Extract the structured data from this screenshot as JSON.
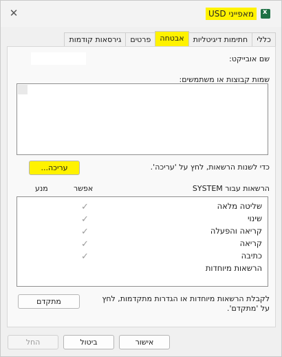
{
  "window": {
    "title": "מאפייני USD",
    "close_glyph": "✕",
    "app_icon": "excel-icon"
  },
  "tabs": [
    {
      "label": "כללי",
      "active": false
    },
    {
      "label": "חתימות דיגיטליות",
      "active": false
    },
    {
      "label": "אבטחה",
      "active": true
    },
    {
      "label": "פרטים",
      "active": false
    },
    {
      "label": "גירסאות קודמות",
      "active": false
    }
  ],
  "security": {
    "object_name_label": "שם אובייקט:",
    "object_name_value": "",
    "groups_label": "שמות קבוצות או משתמשים:",
    "groups": [],
    "edit_hint": "כדי לשנות הרשאות, לחץ על 'עריכה'.",
    "edit_button": "עריכה...",
    "permissions_for_label": "הרשאות עבור SYSTEM",
    "allow_header": "אפשר",
    "deny_header": "מנע",
    "permissions": [
      {
        "name": "שליטה מלאה",
        "allow": true,
        "deny": false
      },
      {
        "name": "שינוי",
        "allow": true,
        "deny": false
      },
      {
        "name": "קריאה והפעלה",
        "allow": true,
        "deny": false
      },
      {
        "name": "קריאה",
        "allow": true,
        "deny": false
      },
      {
        "name": "כתיבה",
        "allow": true,
        "deny": false
      },
      {
        "name": "הרשאות מיוחדות",
        "allow": false,
        "deny": false
      }
    ],
    "check_glyph": "✓",
    "advanced_hint_line1": "לקבלת הרשאות מיוחדות או הגדרות מתקדמות, לחץ",
    "advanced_hint_line2": "על 'מתקדם'.",
    "advanced_button": "מתקדם"
  },
  "footer": {
    "ok_label": "אישור",
    "cancel_label": "ביטול",
    "apply_label": "החל"
  },
  "colors": {
    "highlight": "#fff200",
    "check": "#9a9a9a"
  }
}
